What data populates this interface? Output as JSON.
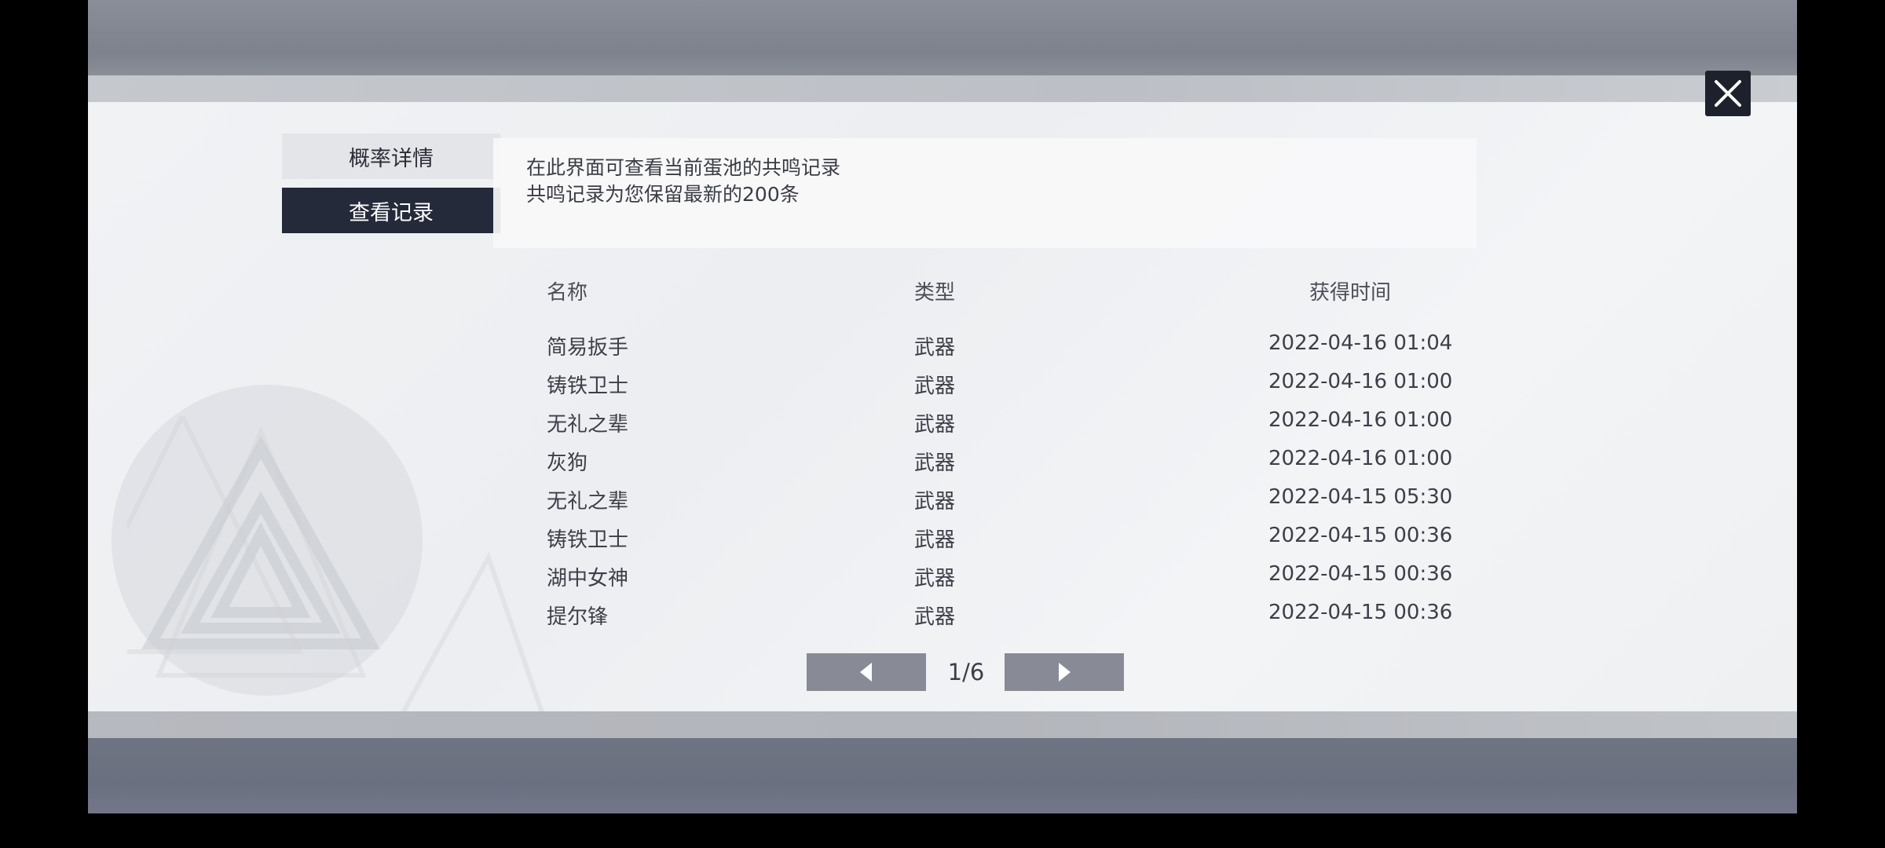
{
  "tabs": [
    {
      "label": "概率详情"
    },
    {
      "label": "查看记录"
    }
  ],
  "info": {
    "line1": "在此界面可查看当前蛋池的共鸣记录",
    "line2": "共鸣记录为您保留最新的200条"
  },
  "table": {
    "headers": {
      "name": "名称",
      "type": "类型",
      "time": "获得时间"
    },
    "rows": [
      {
        "name": "简易扳手",
        "type": "武器",
        "time": "2022-04-16 01:04"
      },
      {
        "name": "铸铁卫士",
        "type": "武器",
        "time": "2022-04-16 01:00"
      },
      {
        "name": "无礼之辈",
        "type": "武器",
        "time": "2022-04-16 01:00"
      },
      {
        "name": "灰狗",
        "type": "武器",
        "time": "2022-04-16 01:00"
      },
      {
        "name": "无礼之辈",
        "type": "武器",
        "time": "2022-04-15 05:30"
      },
      {
        "name": "铸铁卫士",
        "type": "武器",
        "time": "2022-04-15 00:36"
      },
      {
        "name": "湖中女神",
        "type": "武器",
        "time": "2022-04-15 00:36"
      },
      {
        "name": "提尔锋",
        "type": "武器",
        "time": "2022-04-15 00:36"
      }
    ]
  },
  "pagination": {
    "indicator": "1/6",
    "current": 1,
    "total": 6
  },
  "icons": {
    "close": "close-icon",
    "prev": "caret-left-icon",
    "next": "caret-right-icon"
  },
  "colors": {
    "active_tab": "#242a3a",
    "inactive_tab": "#e4e5e8",
    "close_button": "#1d212c",
    "page_button": "#888b95"
  }
}
